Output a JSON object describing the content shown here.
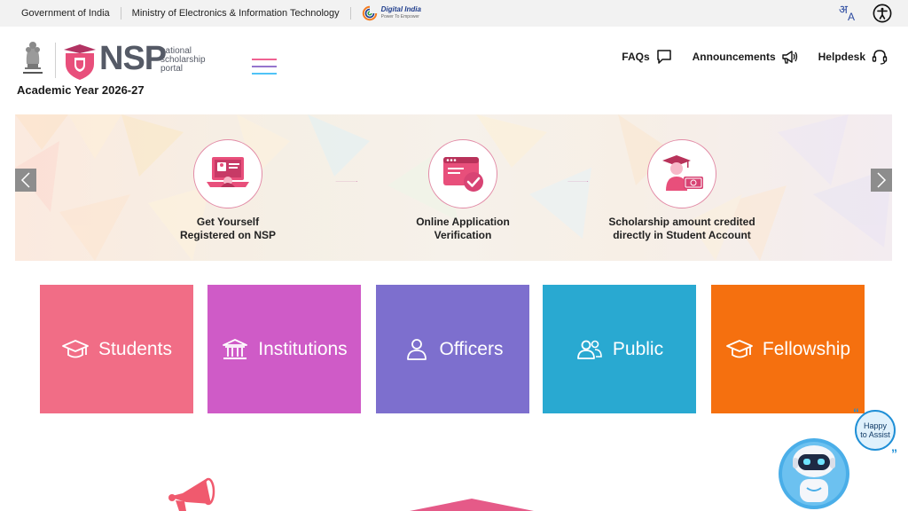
{
  "gov_bar": {
    "government": "Government of India",
    "ministry": "Ministry of Electronics & Information Technology",
    "digital_india_title": "Digital India",
    "digital_india_sub": "Power To Empower",
    "language_icon": "language-icon",
    "accessibility_icon": "accessibility-icon"
  },
  "header": {
    "logo_text": "NSP",
    "logo_sub_1": "national",
    "logo_sub_2": "scholarship",
    "logo_sub_3": "portal",
    "emblem_caption": "सत्यमेव जयते",
    "academic_year": "Academic Year 2026-27",
    "nav": {
      "faqs": "FAQs",
      "announcements": "Announcements",
      "helpdesk": "Helpdesk"
    }
  },
  "banner": {
    "steps": [
      {
        "line1": "Get Yourself",
        "line2": "Registered on NSP"
      },
      {
        "line1": "Online Application",
        "line2": "Verification"
      },
      {
        "line1": "Scholarship amount credited",
        "line2": "directly in Student Account"
      }
    ]
  },
  "tiles": [
    {
      "label": "Students",
      "color": "#f16d86"
    },
    {
      "label": "Institutions",
      "color": "#cf5bc7"
    },
    {
      "label": "Officers",
      "color": "#7d6fce"
    },
    {
      "label": "Public",
      "color": "#29a9d1"
    },
    {
      "label": "Fellowship",
      "color": "#f5700f"
    }
  ],
  "assistant": {
    "line1": "Happy",
    "line2": "to Assist"
  },
  "colors": {
    "brand_pink": "#e84f7b",
    "brand_grey": "#555a66",
    "hamburger_pink": "#f06292",
    "hamburger_purple": "#9575cd",
    "hamburger_blue": "#4fc3f7"
  }
}
